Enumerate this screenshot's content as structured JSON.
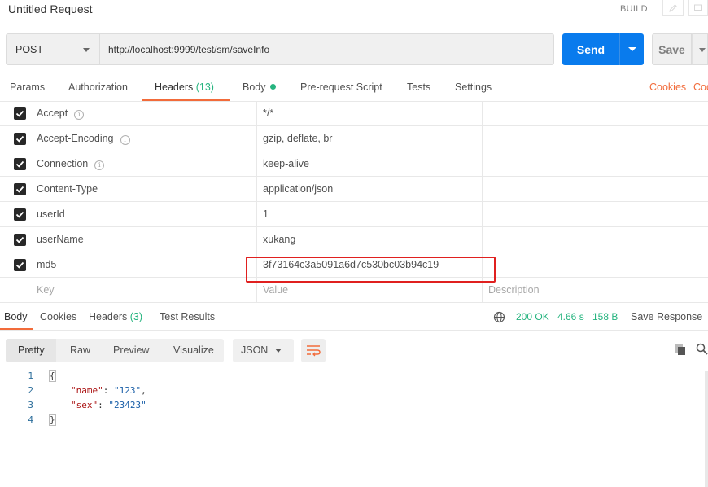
{
  "window": {
    "title": "Untitled Request",
    "build_label": "BUILD"
  },
  "request": {
    "method": "POST",
    "url": "http://localhost:9999/test/sm/saveInfo",
    "send_label": "Send",
    "save_label": "Save"
  },
  "tabs": {
    "params": "Params",
    "authorization": "Authorization",
    "headers": "Headers",
    "headers_count": "(13)",
    "body": "Body",
    "prerequest": "Pre-request Script",
    "tests": "Tests",
    "settings": "Settings",
    "cookies": "Cookies",
    "code_partial": "Cod"
  },
  "headers": {
    "rows": [
      {
        "key": "Accept",
        "value": "*/*",
        "info": true
      },
      {
        "key": "Accept-Encoding",
        "value": "gzip, deflate, br",
        "info": true
      },
      {
        "key": "Connection",
        "value": "keep-alive",
        "info": true
      },
      {
        "key": "Content-Type",
        "value": "application/json",
        "info": false
      },
      {
        "key": "userId",
        "value": "1",
        "info": false
      },
      {
        "key": "userName",
        "value": "xukang",
        "info": false
      },
      {
        "key": "md5",
        "value": "3f73164c3a5091a6d7c530bc03b94c19",
        "info": false
      }
    ],
    "placeholder_key": "Key",
    "placeholder_value": "Value",
    "placeholder_description": "Description"
  },
  "response": {
    "tabs": {
      "body": "Body",
      "cookies": "Cookies",
      "headers": "Headers",
      "headers_count": "(3)",
      "test_results": "Test Results"
    },
    "status": "200 OK",
    "time": "4.66 s",
    "size": "158 B",
    "save_response": "Save Response",
    "view_modes": {
      "pretty": "Pretty",
      "raw": "Raw",
      "preview": "Preview",
      "visualize": "Visualize"
    },
    "format": "JSON",
    "code_lines": [
      {
        "num": "1",
        "text": "{"
      },
      {
        "num": "2",
        "key": "\"name\"",
        "sep": ": ",
        "val": "\"123\"",
        "end": ","
      },
      {
        "num": "3",
        "key": "\"sex\"",
        "sep": ": ",
        "val": "\"23423\"",
        "end": ""
      },
      {
        "num": "4",
        "text": "}"
      }
    ]
  },
  "colors": {
    "accent": "#f26b3a",
    "send": "#097bed",
    "success": "#26b47f",
    "highlight": "#e0201f"
  }
}
